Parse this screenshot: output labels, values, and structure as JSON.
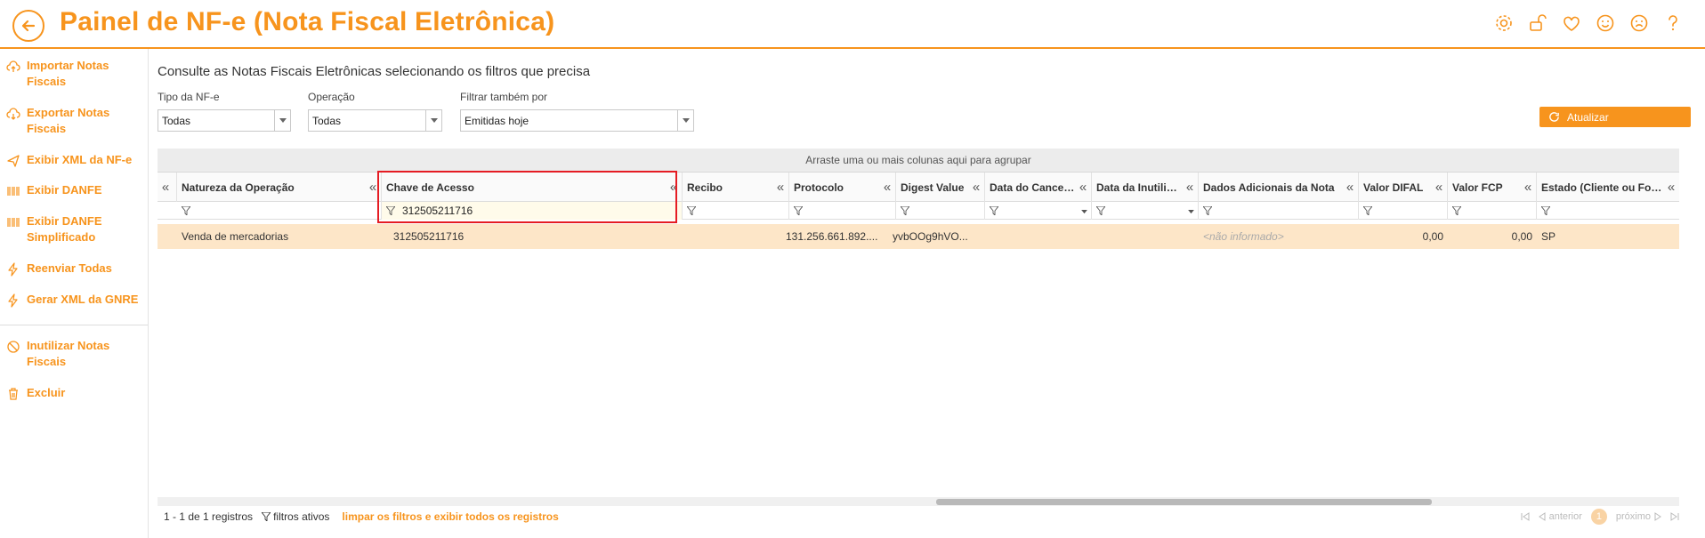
{
  "header": {
    "title": "Painel de NF-e (Nota Fiscal Eletrônica)",
    "icons": [
      "gear-icon",
      "unlock-icon",
      "heart-icon",
      "smile-icon",
      "frown-icon",
      "question-icon"
    ]
  },
  "sidebar": {
    "items": [
      {
        "label": "Importar Notas Fiscais",
        "icon": "cloud-upload-icon"
      },
      {
        "label": "Exportar Notas Fiscais",
        "icon": "cloud-download-icon"
      },
      {
        "label": "Exibir XML da NF-e",
        "icon": "send-icon"
      },
      {
        "label": "Exibir DANFE",
        "icon": "barcode-icon"
      },
      {
        "label": "Exibir DANFE Simplificado",
        "icon": "barcode-icon"
      },
      {
        "label": "Reenviar Todas",
        "icon": "bolt-icon"
      },
      {
        "label": "Gerar XML da GNRE",
        "icon": "bolt-icon"
      },
      {
        "label": "Inutilizar Notas Fiscais",
        "icon": "ban-icon"
      },
      {
        "label": "Excluir",
        "icon": "trash-icon"
      }
    ]
  },
  "main": {
    "subtitle": "Consulte as Notas Fiscais Eletrônicas selecionando os filtros que precisa",
    "filters": {
      "tipo": {
        "label": "Tipo da NF-e",
        "value": "Todas"
      },
      "operacao": {
        "label": "Operação",
        "value": "Todas"
      },
      "filtrar": {
        "label": "Filtrar também por",
        "value": "Emitidas hoje"
      }
    },
    "update_button": "Atualizar"
  },
  "grid": {
    "group_hint": "Arraste uma ou mais colunas aqui para agrupar",
    "columns": [
      {
        "label": "Natureza da Operação"
      },
      {
        "label": "Chave de Acesso"
      },
      {
        "label": "Recibo"
      },
      {
        "label": "Protocolo"
      },
      {
        "label": "Digest Value"
      },
      {
        "label": "Data do Cancelamento"
      },
      {
        "label": "Data da Inutilização"
      },
      {
        "label": "Dados Adicionais da Nota"
      },
      {
        "label": "Valor DIFAL"
      },
      {
        "label": "Valor FCP"
      },
      {
        "label": "Estado (Cliente ou Fornecedor)"
      }
    ],
    "filter_values": {
      "chave": "312505211716"
    },
    "rows": [
      {
        "natureza": "Venda de mercadorias",
        "chave": "312505211716",
        "recibo": "",
        "protocolo": "131.256.661.892....",
        "digest": "yvbOOg9hVO...",
        "data_cancel": "",
        "data_inut": "",
        "dados_adicionais": "<não informado>",
        "valor_difal": "0,00",
        "valor_fcp": "0,00",
        "estado": "SP"
      }
    ]
  },
  "footer": {
    "count": "1 - 1 de 1 registros",
    "filtros_ativos": "filtros ativos",
    "clear": "limpar os filtros e exibir todos os registros",
    "prev": "anterior",
    "next": "próximo",
    "page": "1"
  },
  "colors": {
    "accent": "#f7941d",
    "row_selected": "#fde6c8",
    "highlight_box": "#e51c23"
  }
}
